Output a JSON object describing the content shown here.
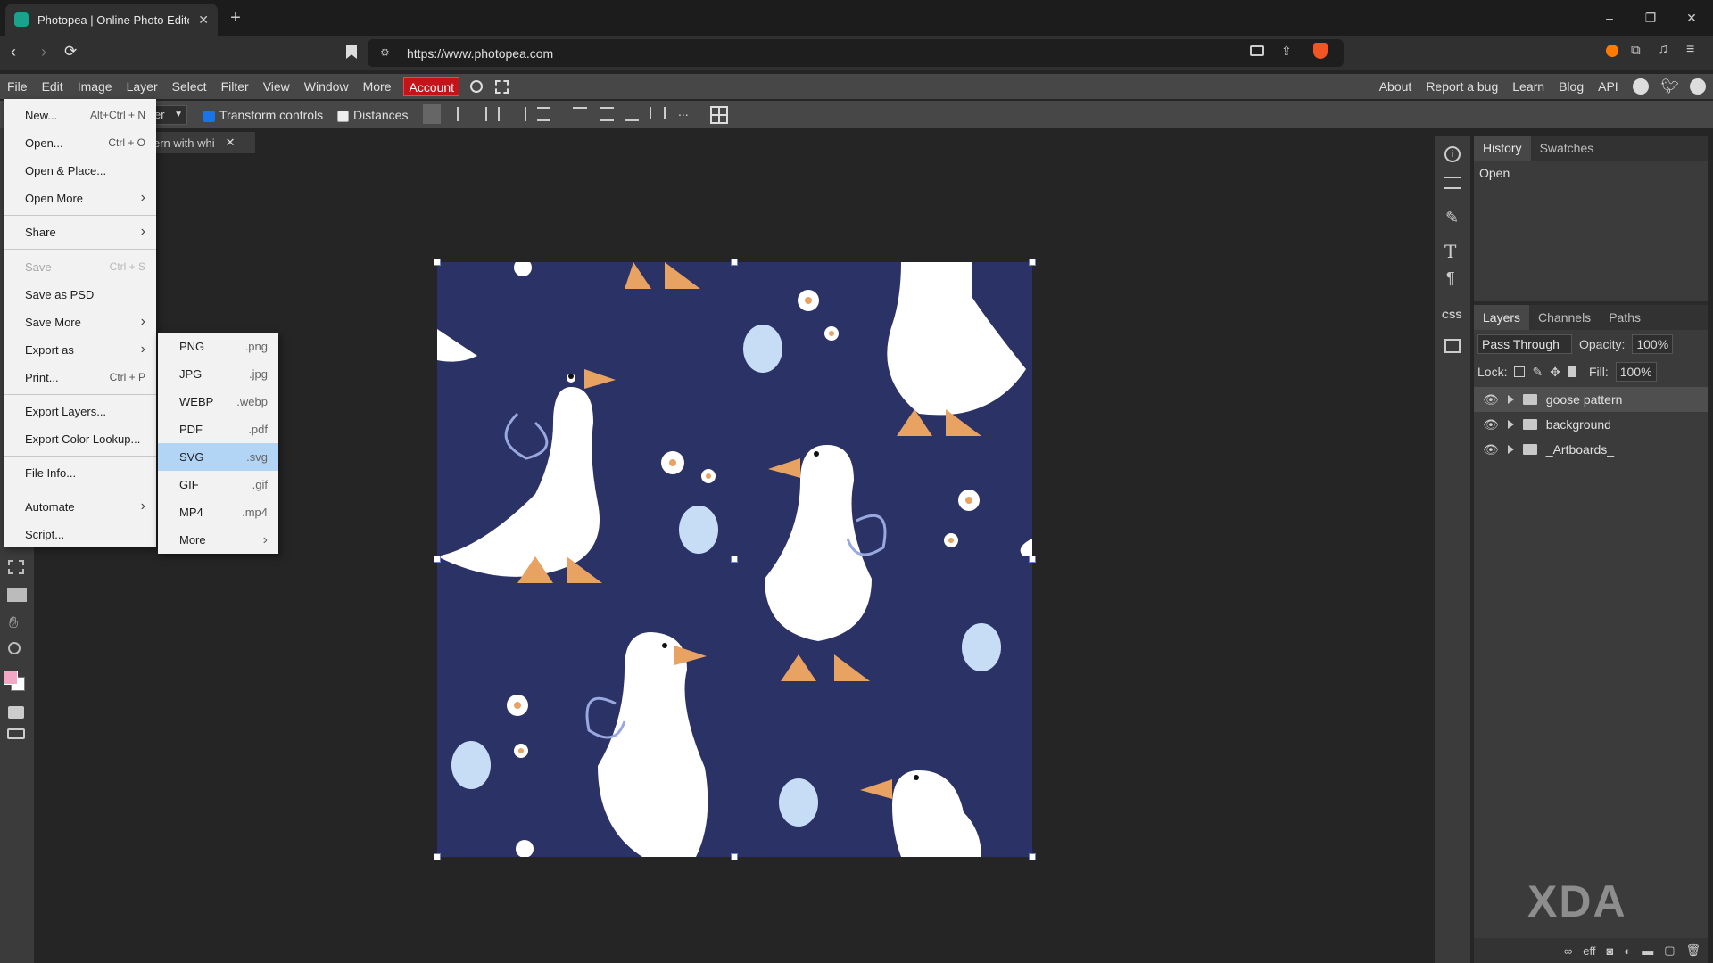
{
  "browser": {
    "tab_title": "Photopea | Online Photo Editor",
    "url": "https://www.photopea.com"
  },
  "menubar": {
    "items": [
      "File",
      "Edit",
      "Image",
      "Layer",
      "Select",
      "Filter",
      "View",
      "Window",
      "More"
    ],
    "account": "Account",
    "right_items": [
      "About",
      "Report a bug",
      "Learn",
      "Blog",
      "API"
    ]
  },
  "options_bar": {
    "layer_select": "er",
    "transform_controls": "Transform controls",
    "distances": "Distances",
    "more": "..."
  },
  "document_tab": {
    "title": "ern with whi"
  },
  "file_menu": {
    "items": [
      {
        "label": "New...",
        "shortcut": "Alt+Ctrl + N"
      },
      {
        "label": "Open...",
        "shortcut": "Ctrl + O"
      },
      {
        "label": "Open & Place...",
        "shortcut": ""
      },
      {
        "label": "Open More",
        "shortcut": ""
      },
      {
        "label": "Share",
        "shortcut": ""
      },
      {
        "label": "Save",
        "shortcut": "Ctrl + S"
      },
      {
        "label": "Save as PSD",
        "shortcut": ""
      },
      {
        "label": "Save More",
        "shortcut": ""
      },
      {
        "label": "Export as",
        "shortcut": ""
      },
      {
        "label": "Print...",
        "shortcut": "Ctrl + P"
      },
      {
        "label": "Export Layers...",
        "shortcut": ""
      },
      {
        "label": "Export Color Lookup...",
        "shortcut": ""
      },
      {
        "label": "File Info...",
        "shortcut": ""
      },
      {
        "label": "Automate",
        "shortcut": ""
      },
      {
        "label": "Script...",
        "shortcut": ""
      }
    ]
  },
  "export_submenu": {
    "items": [
      {
        "label": "PNG",
        "ext": ".png"
      },
      {
        "label": "JPG",
        "ext": ".jpg"
      },
      {
        "label": "WEBP",
        "ext": ".webp"
      },
      {
        "label": "PDF",
        "ext": ".pdf"
      },
      {
        "label": "SVG",
        "ext": ".svg"
      },
      {
        "label": "GIF",
        "ext": ".gif"
      },
      {
        "label": "MP4",
        "ext": ".mp4"
      },
      {
        "label": "More",
        "ext": ""
      }
    ]
  },
  "right_panel": {
    "history_tabs": [
      "History",
      "Swatches"
    ],
    "history_items": [
      "Open"
    ],
    "layer_tabs": [
      "Layers",
      "Channels",
      "Paths"
    ],
    "blend_mode": "Pass Through",
    "opacity_label": "Opacity:",
    "opacity_value": "100%",
    "lock_label": "Lock:",
    "fill_label": "Fill:",
    "fill_value": "100%",
    "layers": [
      "goose pattern",
      "background",
      "_Artboards_"
    ],
    "icon_css": "CSS"
  },
  "watermark": "XDA",
  "colors": {
    "canvas_bg": "#2b3366",
    "account_red": "#c4141a",
    "highlight_blue": "#b3d5f5",
    "foreground_swatch": "#f4a7c4",
    "background_swatch": "#ffffff"
  }
}
